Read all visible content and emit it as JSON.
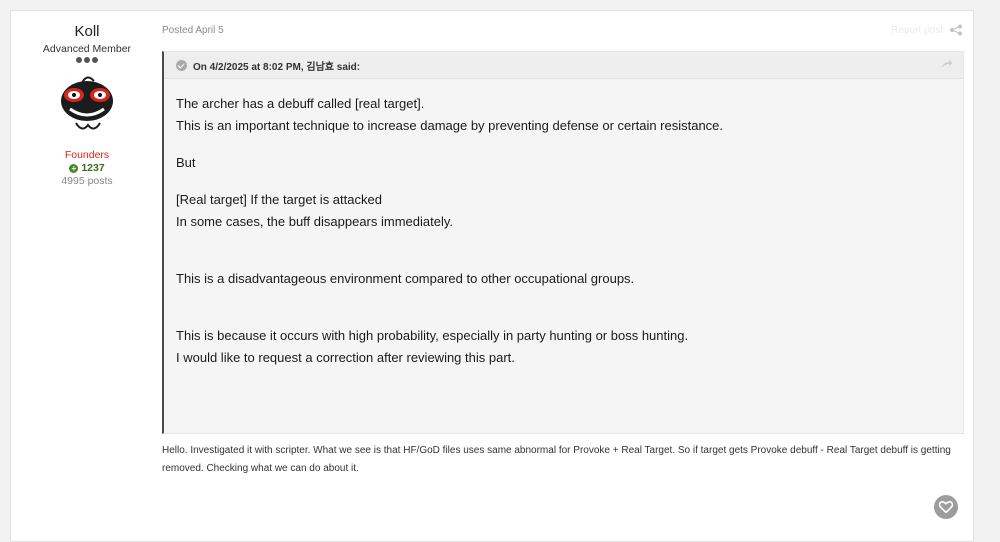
{
  "author": {
    "name": "Koll",
    "title": "Advanced Member",
    "group": "Founders",
    "reputation": "1237",
    "post_count": "4995 posts"
  },
  "post": {
    "posted": "Posted April 5",
    "report_label": "Report post"
  },
  "quote": {
    "citation": "On 4/2/2025 at 8:02 PM, 김남효 said:",
    "lines": [
      "The archer has a debuff called [real target].",
      "This is an important technique to increase damage by preventing defense or certain resistance.",
      "But",
      "[Real target] If the target is attacked",
      "In some cases, the buff disappears immediately.",
      "This is a disadvantageous environment compared to other occupational groups.",
      "This is because it occurs with high probability, especially in party hunting or boss hunting.",
      "I would like to request a correction after reviewing this part."
    ]
  },
  "reply": {
    "text": "Hello. Investigated it with scripter. What we see is that HF/GoD files uses same abnormal for Provoke + Real Target. So if target gets Provoke debuff - Real Target debuff is getting removed. Checking what we can do about it."
  },
  "icons": {
    "share": "share-icon",
    "quote_link": "arrow-icon",
    "like": "heart-icon",
    "reputation": "plus-circle-icon"
  }
}
